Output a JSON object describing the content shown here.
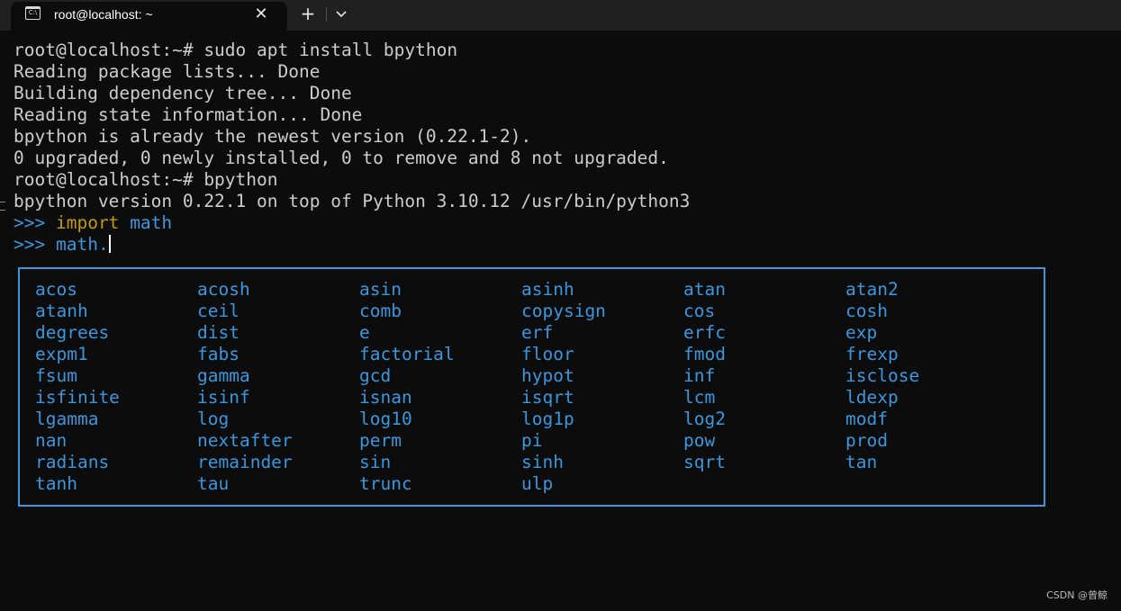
{
  "window": {
    "tab_title": "root@localhost: ~",
    "icon_glyph": "C:\\",
    "close_glyph": "✕",
    "new_tab_glyph": "+"
  },
  "terminal": {
    "lines": [
      "root@localhost:~# sudo apt install bpython",
      "Reading package lists... Done",
      "Building dependency tree... Done",
      "Reading state information... Done",
      "bpython is already the newest version (0.22.1-2).",
      "0 upgraded, 0 newly installed, 0 to remove and 8 not upgraded.",
      "root@localhost:~# bpython",
      "bpython version 0.22.1 on top of Python 3.10.12 /usr/bin/python3"
    ],
    "repl_prompt": ">>>",
    "repl_line1_keyword": "import",
    "repl_line1_rest": "math",
    "repl_line2_input": "math."
  },
  "completions": [
    [
      "acos",
      "acosh",
      "asin",
      "asinh",
      "atan",
      "atan2"
    ],
    [
      "atanh",
      "ceil",
      "comb",
      "copysign",
      "cos",
      "cosh"
    ],
    [
      "degrees",
      "dist",
      "e",
      "erf",
      "erfc",
      "exp"
    ],
    [
      "expm1",
      "fabs",
      "factorial",
      "floor",
      "fmod",
      "frexp"
    ],
    [
      "fsum",
      "gamma",
      "gcd",
      "hypot",
      "inf",
      "isclose"
    ],
    [
      "isfinite",
      "isinf",
      "isnan",
      "isqrt",
      "lcm",
      "ldexp"
    ],
    [
      "lgamma",
      "log",
      "log10",
      "log1p",
      "log2",
      "modf"
    ],
    [
      "nan",
      "nextafter",
      "perm",
      "pi",
      "pow",
      "prod"
    ],
    [
      "radians",
      "remainder",
      "sin",
      "sinh",
      "sqrt",
      "tan"
    ],
    [
      "tanh",
      "tau",
      "trunc",
      "ulp"
    ]
  ],
  "watermark": "CSDN @曾鲸",
  "colors": {
    "background": "#0c0c0c",
    "foreground": "#cccccc",
    "accent_blue": "#3a96dd",
    "keyword_yellow": "#c19c00"
  }
}
